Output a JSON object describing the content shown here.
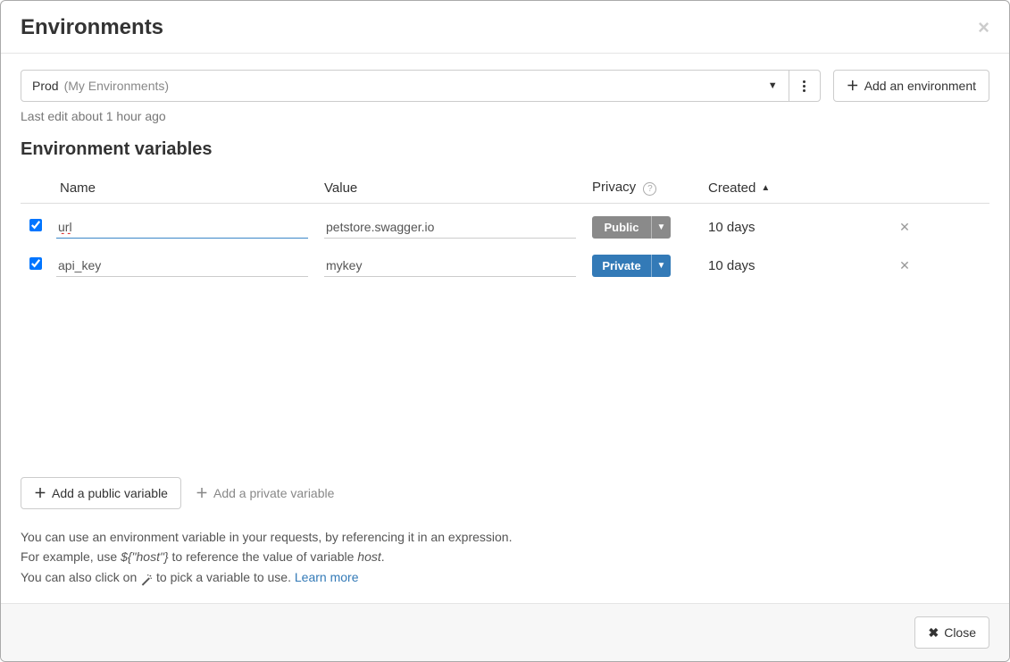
{
  "modal": {
    "title": "Environments",
    "close_label": "Close"
  },
  "selector": {
    "env_name": "Prod",
    "env_group": "(My Environments)",
    "add_button": "Add an environment"
  },
  "last_edit": "Last edit about 1 hour ago",
  "section_title": "Environment variables",
  "columns": {
    "name": "Name",
    "value": "Value",
    "privacy": "Privacy",
    "created": "Created"
  },
  "rows": [
    {
      "checked": true,
      "name": "url",
      "value": "petstore.swagger.io",
      "privacy": "Public",
      "created": "10 days"
    },
    {
      "checked": true,
      "name": "api_key",
      "value": "mykey",
      "privacy": "Private",
      "created": "10 days"
    }
  ],
  "actions": {
    "add_public": "Add a public variable",
    "add_private": "Add a private variable"
  },
  "help": {
    "line1": "You can use an environment variable in your requests, by referencing it in an expression.",
    "line2a": "For example, use ",
    "line2b": "${\"host\"}",
    "line2c": " to reference the value of variable ",
    "line2d": "host",
    "line2e": ".",
    "line3a": "You can also click on ",
    "line3b": " to pick a variable to use. ",
    "learn_more": "Learn more"
  }
}
